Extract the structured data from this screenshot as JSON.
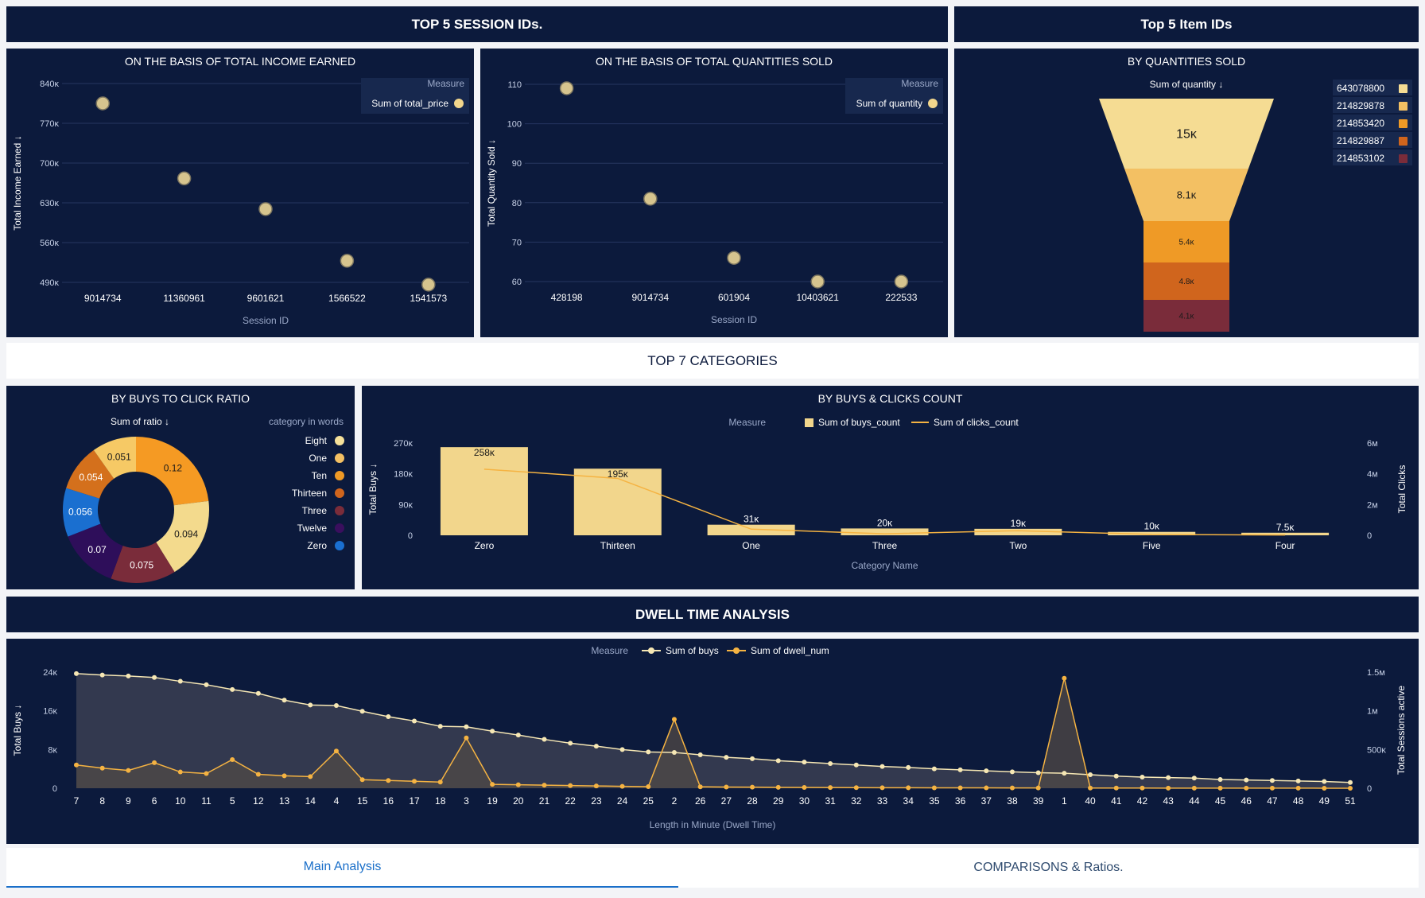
{
  "headers": {
    "top_sessions": "TOP 5 SESSION IDs.",
    "top_items": "Top 5 Item IDs",
    "top_categories": "TOP 7 CATEGORIES",
    "dwell": "DWELL TIME ANALYSIS"
  },
  "tabs": [
    {
      "label": "Main Analysis",
      "active": true
    },
    {
      "label": "COMPARISONS & Ratios.",
      "active": false
    }
  ],
  "colors": {
    "navy": "#0c1a3c",
    "gold": "#f2d68c",
    "accent": "#f5b342",
    "tab_active": "#1a6fc9"
  },
  "chart_data": [
    {
      "id": "income",
      "type": "scatter",
      "title": "ON THE BASIS OF TOTAL INCOME EARNED",
      "xlabel": "Session ID",
      "ylabel": "Total Income Earned ↓",
      "categories": [
        "9014734",
        "11360961",
        "9601621",
        "1566522",
        "1541573"
      ],
      "values": [
        805000,
        673000,
        619000,
        528000,
        486000
      ],
      "ylim": [
        490000,
        840000
      ],
      "yticks": [
        "490ĸ",
        "560ĸ",
        "630ĸ",
        "700ĸ",
        "770ĸ",
        "840ĸ"
      ],
      "legend_title": "Measure",
      "series_name": "Sum of total_price",
      "legend_position": "top-right",
      "grid": true
    },
    {
      "id": "quantities",
      "type": "scatter",
      "title": "ON THE BASIS OF TOTAL QUANTITIES SOLD",
      "xlabel": "Session ID",
      "ylabel": "Total Quantity Sold ↓",
      "categories": [
        "428198",
        "9014734",
        "601904",
        "10403621",
        "222533"
      ],
      "values": [
        109,
        81,
        66,
        60,
        60
      ],
      "ylim": [
        60,
        110
      ],
      "yticks": [
        "60",
        "70",
        "80",
        "90",
        "100",
        "110"
      ],
      "legend_title": "Measure",
      "series_name": "Sum of quantity",
      "legend_position": "top-right",
      "grid": true
    },
    {
      "id": "funnel",
      "type": "funnel",
      "title": "BY QUANTITIES SOLD",
      "measure_label": "Sum of quantity ↓",
      "categories": [
        "643078800",
        "214829878",
        "214853420",
        "214829887",
        "214853102"
      ],
      "values": [
        15000,
        8100,
        5400,
        4800,
        4100
      ],
      "value_labels": [
        "15ĸ",
        "8.1ĸ",
        "5.4ĸ",
        "4.8ĸ",
        "4.1ĸ"
      ],
      "colors": [
        "#f5dc93",
        "#f3c063",
        "#ef9a26",
        "#d0651d",
        "#7a2c3a"
      ],
      "legend_position": "right"
    },
    {
      "id": "ratio",
      "type": "pie",
      "title": "BY BUYS TO CLICK RATIO",
      "measure_label": "Sum of ratio ↓",
      "legend_title": "category in words",
      "categories": [
        "Eight",
        "One",
        "Ten",
        "Thirteen",
        "Three",
        "Twelve",
        "Zero"
      ],
      "values": [
        0.12,
        0.094,
        0.075,
        0.07,
        0.056,
        0.054,
        0.051
      ],
      "value_labels": [
        "0.12",
        "0.094",
        "0.075",
        "0.07",
        "0.056",
        "0.054",
        "0.051"
      ],
      "colors": [
        "#f59a23",
        "#f3da8d",
        "#7a2c3a",
        "#2e0e5a",
        "#1a6fd0",
        "#d4701c",
        "#f6c965"
      ],
      "legend_colors": [
        "#f6e19a",
        "#f3c063",
        "#ef9a26",
        "#d0651d",
        "#7a2c3a",
        "#3a0f5e",
        "#1a6fd0"
      ],
      "legend_position": "right"
    },
    {
      "id": "buys_clicks",
      "type": "bar",
      "title": "BY BUYS & CLICKS COUNT",
      "xlabel": "Category Name",
      "ylabel": "Total Buys ↓",
      "y2label": "Total Clicks",
      "legend_title": "Measure",
      "categories": [
        "Zero",
        "Thirteen",
        "One",
        "Three",
        "Two",
        "Five",
        "Four"
      ],
      "series": [
        {
          "name": "Sum of buys_count",
          "kind": "bar",
          "values": [
            258000,
            195000,
            31000,
            20000,
            19000,
            10000,
            7500
          ],
          "labels": [
            "258ĸ",
            "195ĸ",
            "31ĸ",
            "20ĸ",
            "19ĸ",
            "10ĸ",
            "7.5ĸ"
          ]
        },
        {
          "name": "Sum of clicks_count",
          "kind": "line",
          "axis": "right",
          "values": [
            4300000,
            3700000,
            400000,
            100000,
            300000,
            60000,
            20000
          ]
        }
      ],
      "ylim": [
        0,
        270000
      ],
      "yticks": [
        "0",
        "90ĸ",
        "180ĸ",
        "270ĸ"
      ],
      "y2lim": [
        0,
        6000000
      ],
      "y2ticks": [
        "0",
        "2м",
        "4м",
        "6м"
      ],
      "legend_position": "top"
    },
    {
      "id": "dwell",
      "type": "line",
      "title": "",
      "xlabel": "Length in Minute (Dwell Time)",
      "ylabel": "Total Buys ↓",
      "y2label": "Total Sessions active",
      "legend_title": "Measure",
      "categories": [
        "7",
        "8",
        "9",
        "6",
        "10",
        "11",
        "5",
        "12",
        "13",
        "14",
        "4",
        "15",
        "16",
        "17",
        "18",
        "3",
        "19",
        "20",
        "21",
        "22",
        "23",
        "24",
        "25",
        "2",
        "26",
        "27",
        "28",
        "29",
        "30",
        "31",
        "32",
        "33",
        "34",
        "35",
        "36",
        "37",
        "38",
        "39",
        "1",
        "40",
        "41",
        "42",
        "43",
        "44",
        "45",
        "46",
        "47",
        "48",
        "49",
        "51"
      ],
      "series": [
        {
          "name": "Sum of buys",
          "axis": "left",
          "values": [
            23700,
            23400,
            23200,
            22900,
            22100,
            21400,
            20400,
            19600,
            18200,
            17200,
            17100,
            15900,
            14800,
            13900,
            12800,
            12700,
            11800,
            11000,
            10100,
            9300,
            8700,
            8000,
            7500,
            7400,
            6900,
            6400,
            6100,
            5700,
            5400,
            5100,
            4800,
            4500,
            4300,
            4000,
            3800,
            3600,
            3400,
            3200,
            3100,
            2800,
            2500,
            2300,
            2200,
            2100,
            1800,
            1700,
            1600,
            1500,
            1400,
            1200
          ]
        },
        {
          "name": "Sum of dwell_num",
          "axis": "right",
          "values": [
            300000,
            260000,
            230000,
            330000,
            210000,
            190000,
            370000,
            180000,
            160000,
            150000,
            480000,
            110000,
            100000,
            90000,
            80000,
            650000,
            50000,
            45000,
            40000,
            35000,
            30000,
            25000,
            20000,
            890000,
            18000,
            16000,
            14000,
            12000,
            10000,
            9000,
            8000,
            7000,
            6000,
            5500,
            5000,
            4500,
            4000,
            3500,
            1420000,
            3000,
            2500,
            2000,
            1800,
            1600,
            1400,
            1200,
            1000,
            800,
            600,
            500
          ]
        }
      ],
      "ylim": [
        0,
        24000
      ],
      "yticks": [
        "0",
        "8ĸ",
        "16ĸ",
        "24ĸ"
      ],
      "y2lim": [
        0,
        1500000
      ],
      "y2ticks": [
        "0",
        "500ĸ",
        "1м",
        "1.5м"
      ],
      "legend_position": "top"
    }
  ]
}
